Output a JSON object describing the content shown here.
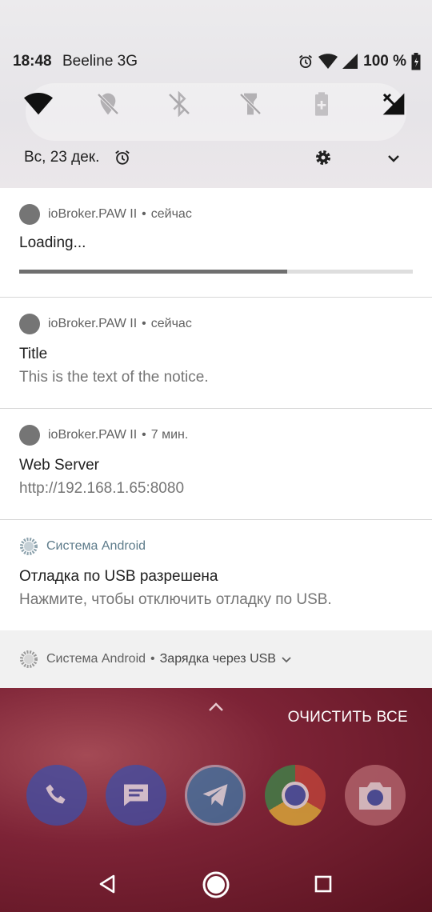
{
  "status_bar": {
    "time": "18:48",
    "carrier": "Beeline 3G",
    "battery": "100 %"
  },
  "quick_settings": {
    "tiles": [
      "wifi-icon",
      "location-off-icon",
      "bluetooth-off-icon",
      "flashlight-off-icon",
      "battery-saver-icon",
      "mobile-data-off-icon"
    ],
    "date": "Вс, 23 дек."
  },
  "notifications": [
    {
      "app": "ioBroker.PAW II",
      "when": "сейчас",
      "title": "Loading...",
      "progress": 0.68
    },
    {
      "app": "ioBroker.PAW II",
      "when": "сейчас",
      "title": "Title",
      "text": "This is the text of the notice."
    },
    {
      "app": "ioBroker.PAW II",
      "when": "7 мин.",
      "title": "Web Server",
      "text": "http://192.168.1.65:8080"
    },
    {
      "app": "Система Android",
      "title": "Отладка по USB разрешена",
      "text": "Нажмите, чтобы отключить отладку по USB."
    }
  ],
  "collapsed_notification": {
    "app": "Система Android",
    "text": "Зарядка через USB"
  },
  "home": {
    "clear_all": "ОЧИСТИТЬ ВСЕ",
    "dock": [
      "phone-icon",
      "messages-icon",
      "telegram-icon",
      "chrome-icon",
      "camera-icon"
    ]
  },
  "colors": {
    "accent_android": "#5e7c8b",
    "wallpaper": "#7d2336"
  }
}
